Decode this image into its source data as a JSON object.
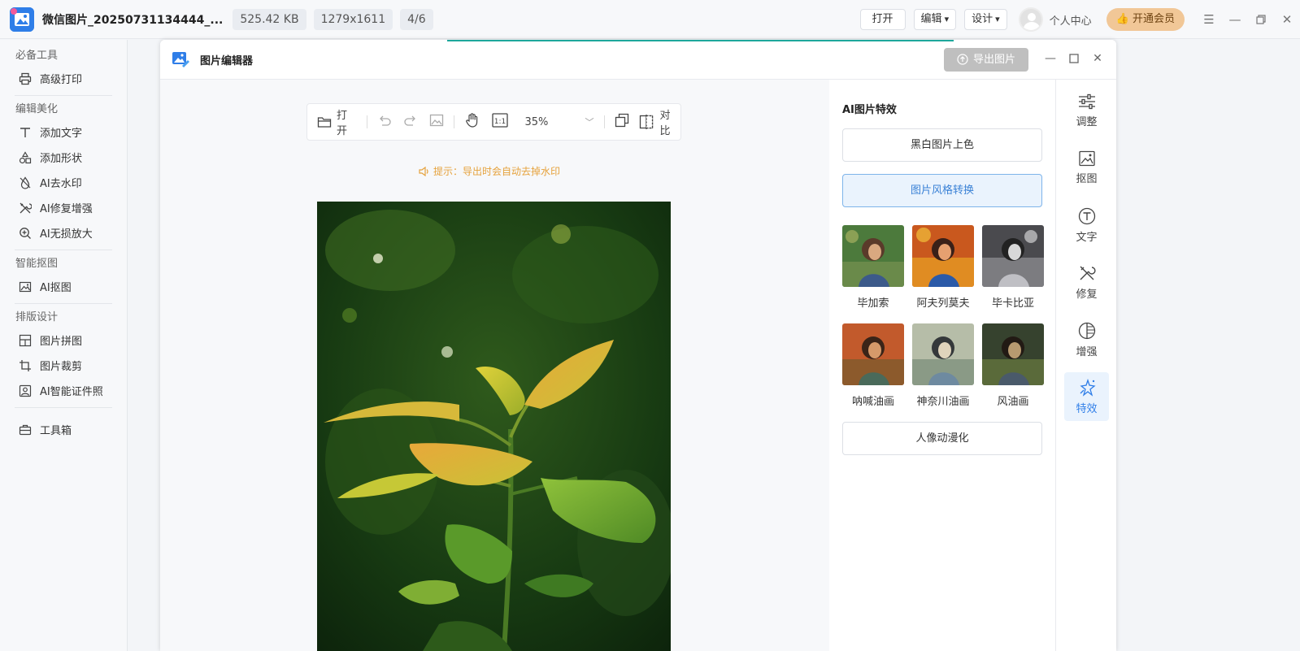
{
  "topbar": {
    "file_name": "微信图片_20250731134444_...",
    "file_size": "525.42 KB",
    "dimensions": "1279x1611",
    "page_index": "4/6",
    "open_label": "打开",
    "edit_label": "编辑",
    "design_label": "设计",
    "user_center": "个人中心",
    "vip_label": "开通会员"
  },
  "sidebar": {
    "sections": [
      {
        "title": "必备工具",
        "items": [
          {
            "label": "高级打印",
            "icon": "printer-icon"
          }
        ]
      },
      {
        "title": "编辑美化",
        "items": [
          {
            "label": "添加文字",
            "icon": "text-icon"
          },
          {
            "label": "添加形状",
            "icon": "shapes-icon"
          },
          {
            "label": "AI去水印",
            "icon": "drop-icon"
          },
          {
            "label": "AI修复增强",
            "icon": "tools-icon"
          },
          {
            "label": "AI无损放大",
            "icon": "zoom-in-icon"
          }
        ]
      },
      {
        "title": "智能抠图",
        "items": [
          {
            "label": "AI抠图",
            "icon": "image-icon"
          }
        ]
      },
      {
        "title": "排版设计",
        "items": [
          {
            "label": "图片拼图",
            "icon": "collage-icon"
          },
          {
            "label": "图片裁剪",
            "icon": "crop-icon"
          },
          {
            "label": "AI智能证件照",
            "icon": "id-photo-icon"
          }
        ]
      },
      {
        "title": "",
        "items": [
          {
            "label": "工具箱",
            "icon": "toolbox-icon"
          }
        ]
      }
    ]
  },
  "editor": {
    "title": "图片编辑器",
    "export_label": "导出图片",
    "toolbar": {
      "open_label": "打开",
      "zoom": "35%",
      "compare_label": "对比"
    },
    "hint": "提示：导出时会自动去掉水印"
  },
  "panel": {
    "title": "AI图片特效",
    "btn_colorize": "黑白图片上色",
    "btn_style": "图片风格转换",
    "btn_anime": "人像动漫化",
    "styles": [
      "毕加索",
      "阿夫列莫夫",
      "毕卡比亚",
      "呐喊油画",
      "神奈川油画",
      "风油画"
    ]
  },
  "tabs": {
    "items": [
      "调整",
      "抠图",
      "文字",
      "修复",
      "增强",
      "特效"
    ],
    "active": "特效"
  },
  "colors": {
    "accent": "#2f7ee8",
    "vip": "#f1c797",
    "hint": "#e6a23c"
  }
}
